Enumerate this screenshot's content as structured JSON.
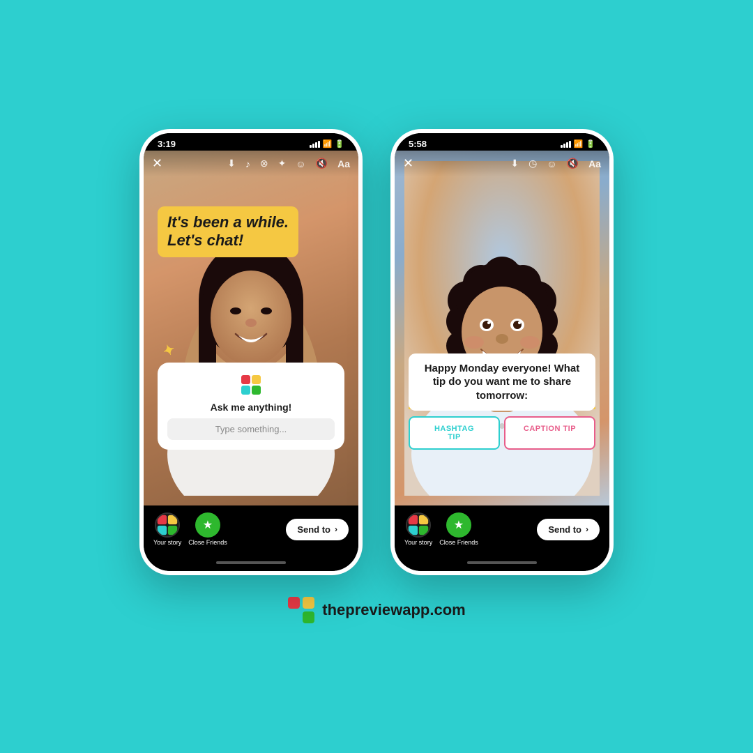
{
  "background_color": "#2dcfcf",
  "branding": {
    "logo_alt": "Preview App Logo",
    "website": "thepreviewapp.com"
  },
  "phone1": {
    "status_time": "3:19",
    "caption": "It's been a while.\nLet's chat!",
    "caption_bg_color": "#f5c842",
    "ask_widget": {
      "title": "Ask me anything!",
      "input_placeholder": "Type something..."
    },
    "bottom_bar": {
      "your_story_label": "Your story",
      "close_friends_label": "Close Friends",
      "send_to_label": "Send to"
    }
  },
  "phone2": {
    "status_time": "5:58",
    "poll_caption": "Happy Monday everyone! What tip do you want me to share tomorrow:",
    "poll_option_1": "HASHTAG\nTIP",
    "poll_option_2": "CAPTION TIP",
    "yellow_line": true,
    "bottom_bar": {
      "your_story_label": "Your story",
      "close_friends_label": "Close Friends",
      "send_to_label": "Send to"
    }
  }
}
